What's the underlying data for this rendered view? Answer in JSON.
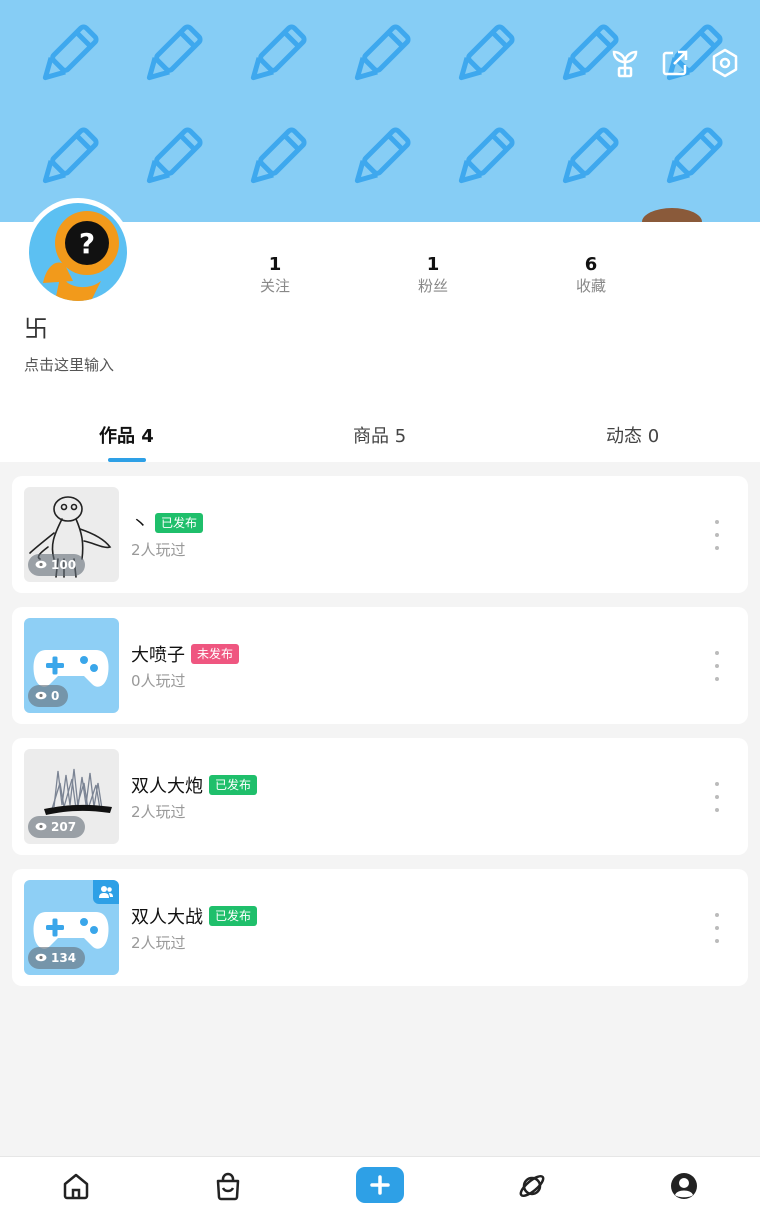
{
  "profile": {
    "username": "卐",
    "bio_placeholder": "点击这里输入",
    "stats": [
      {
        "value": "1",
        "label": "关注"
      },
      {
        "value": "1",
        "label": "粉丝"
      },
      {
        "value": "6",
        "label": "收藏"
      }
    ]
  },
  "header_icons": [
    "sprout-icon",
    "share-icon",
    "settings-icon"
  ],
  "tabs": [
    {
      "label": "作品 4",
      "active": true
    },
    {
      "label": "商品 5",
      "active": false
    },
    {
      "label": "动态 0",
      "active": false
    }
  ],
  "works": [
    {
      "title": "丶",
      "status": "已发布",
      "plays": "2人玩过",
      "views": "100",
      "thumb": "sketch-creature"
    },
    {
      "title": "大喷子",
      "status": "未发布",
      "plays": "0人玩过",
      "views": "0",
      "thumb": "gamepad"
    },
    {
      "title": "双人大炮",
      "status": "已发布",
      "plays": "2人玩过",
      "views": "207",
      "thumb": "sketch-grass"
    },
    {
      "title": "双人大战",
      "status": "已发布",
      "plays": "2人玩过",
      "views": "134",
      "thumb": "gamepad-coop"
    }
  ],
  "bottom_nav": [
    "home-icon",
    "shop-bag-icon",
    "add-icon",
    "planet-icon",
    "profile-icon"
  ],
  "colors": {
    "banner": "#86cdf5",
    "accent": "#2ea0e6",
    "published": "#1fbf6b",
    "unpublished": "#ef5680"
  }
}
